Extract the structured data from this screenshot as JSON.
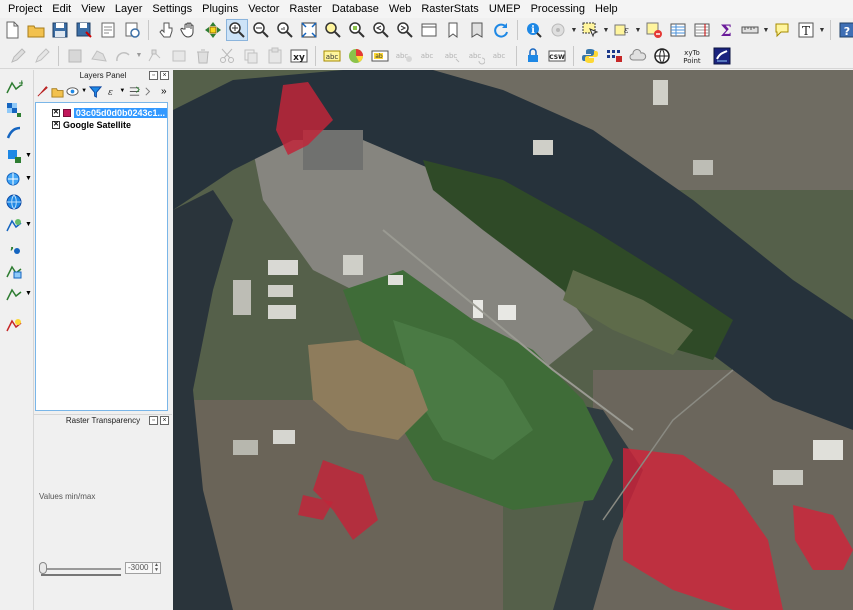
{
  "menubar": {
    "items": [
      "Project",
      "Edit",
      "View",
      "Layer",
      "Settings",
      "Plugins",
      "Vector",
      "Raster",
      "Database",
      "Web",
      "RasterStats",
      "UMEP",
      "Processing",
      "Help"
    ]
  },
  "toolbar2": {
    "csw_label": "CSW",
    "xy_label": "xy",
    "xytopoint_line1": "xyTo",
    "xytopoint_line2": "Point"
  },
  "layers_panel": {
    "title": "Layers Panel",
    "layers": [
      {
        "name": "03c05d0d0b0243c1...",
        "checked": true,
        "selected": true,
        "has_swatch": true,
        "swatch_color": "#c2185b"
      },
      {
        "name": "Google Satellite",
        "checked": true,
        "selected": false,
        "has_swatch": false
      }
    ]
  },
  "transparency_panel": {
    "title": "Raster Transparency",
    "values_label": "Values min/max",
    "spin_value": "-3000"
  },
  "colors": {
    "river": "#23303a",
    "vegetation_dark": "#2c4a24",
    "wetland_green": "#3d6b35",
    "industrial_gray": "#8a8a86",
    "selection_red": "#d3233a",
    "urban": "#6e6a60"
  },
  "icons": {
    "symbol_map": "x-symbol"
  }
}
